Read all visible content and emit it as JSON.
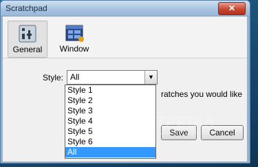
{
  "window": {
    "title": "Scratchpad",
    "close_glyph": "✕"
  },
  "toolbar": {
    "items": [
      {
        "label": "General",
        "icon": "sliders-icon",
        "active": true
      },
      {
        "label": "Window",
        "icon": "window-grid-icon",
        "active": false
      }
    ]
  },
  "content": {
    "style_label": "Style:",
    "style_value": "All",
    "description": "ratches you would like",
    "save_label": "Save",
    "cancel_label": "Cancel"
  },
  "dropdown": {
    "options": [
      "Style 1",
      "Style 2",
      "Style 3",
      "Style 4",
      "Style 5",
      "Style 6",
      "All"
    ],
    "selected": "All"
  },
  "colors": {
    "selection": "#3399ff",
    "close_button": "#c9462f",
    "title_bar": "#a8c4e0"
  }
}
